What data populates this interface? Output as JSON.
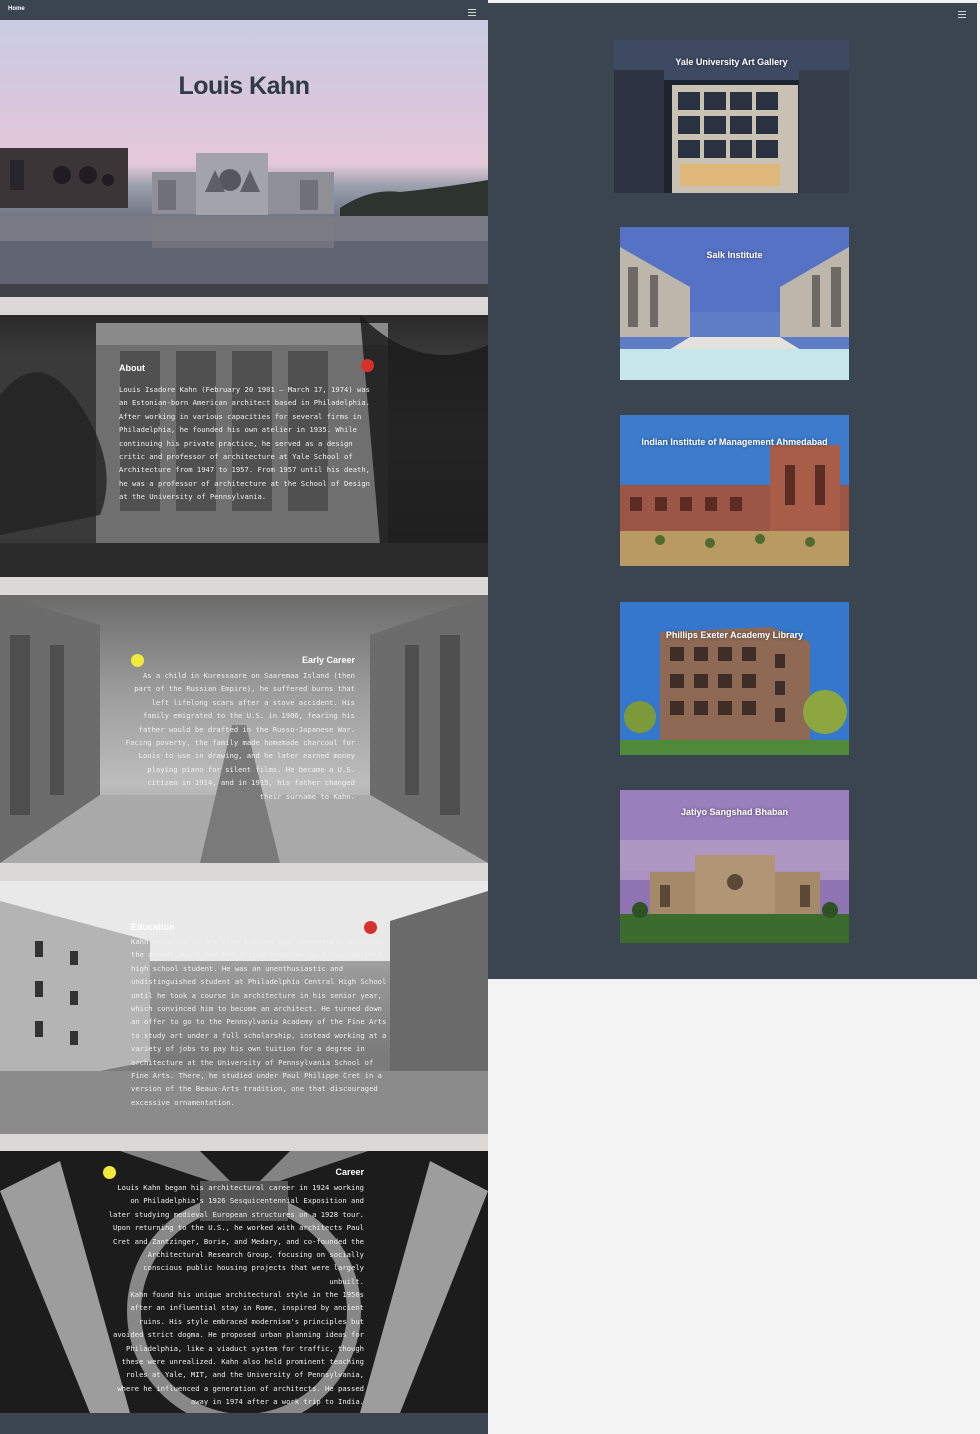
{
  "nav": {
    "home_label": "Home"
  },
  "hero": {
    "title": "Louis Kahn"
  },
  "about": {
    "title": "About",
    "text": "Louis Isadore Kahn (February 20 1901 – March 17, 1974) was an Estonian-born American architect based in Philadelphia. After working in various capacities for several firms in Philadelphia, he founded his own atelier in 1935. While continuing his private practice, he served as a design critic and professor of architecture at Yale School of Architecture from 1947 to 1957. From 1957 until his death, he was a professor of architecture at the School of Design at the University of Pennsylvania."
  },
  "early_career": {
    "title": "Early Career",
    "text": "As a child in Kuressaare on Saaremaa Island (then part of the Russian Empire), he suffered burns that left lifelong scars after a stove accident. His family emigrated to the U.S. in 1906, fearing his father would be drafted in the Russo-Japanese War. Facing poverty, the family made homemade charcoal for Louis to use in drawing, and he later earned money playing piano for silent films. He became a U.S. citizen in 1914, and in 1915, his father changed their surname to Kahn."
  },
  "education": {
    "title": "Education",
    "text": "Kahn excelled in art from a young age, repeatedly winning the annual award for the best watercolor by a Philadelphia high school student. He was an unenthusiastic and undistinguished student at Philadelphia Central High School until he took a course in architecture in his senior year, which convinced him to become an architect. He turned down an offer to go to the Pennsylvania Academy of the Fine Arts to study art under a full scholarship, instead working at a variety of jobs to pay his own tuition for a degree in architecture at the University of Pennsylvania School of Fine Arts. There, he studied under Paul Philippe Cret in a version of the Beaux-Arts tradition, one that discouraged excessive ornamentation."
  },
  "career": {
    "title": "Career",
    "text1": "Louis Kahn began his architectural career in 1924 working on Philadelphia's 1926 Sesquicentennial Exposition and later studying medieval European structures on a 1928 tour. Upon returning to the U.S., he worked with architects Paul Cret and Zantzinger, Borie, and Medary, and co-founded the Architectural Research Group, focusing on socially conscious public housing projects that were largely unbuilt.",
    "text2": "Kahn found his unique architectural style in the 1950s after an influential stay in Rome, inspired by ancient ruins. His style embraced modernism's principles but avoided strict dogma. He proposed urban planning ideas for Philadelphia, like a viaduct system for traffic, though these were unrealized. Kahn also held prominent teaching roles at Yale, MIT, and the University of Pennsylvania, where he influenced a generation of architects. He passed away in 1974 after a work trip to India."
  },
  "works": [
    {
      "title": "Yale University Art Gallery"
    },
    {
      "title": "Salk Institute"
    },
    {
      "title": "Indian Institute of Management Ahmedabad"
    },
    {
      "title": "Phillips Exeter Academy Library"
    },
    {
      "title": "Jatiyo Sangshad Bhaban"
    }
  ],
  "colors": {
    "panel": "#3a4550",
    "accent_red": "#d8302b",
    "accent_yellow": "#f2ea3a"
  },
  "icons": [
    "hamburger-menu-icon"
  ]
}
